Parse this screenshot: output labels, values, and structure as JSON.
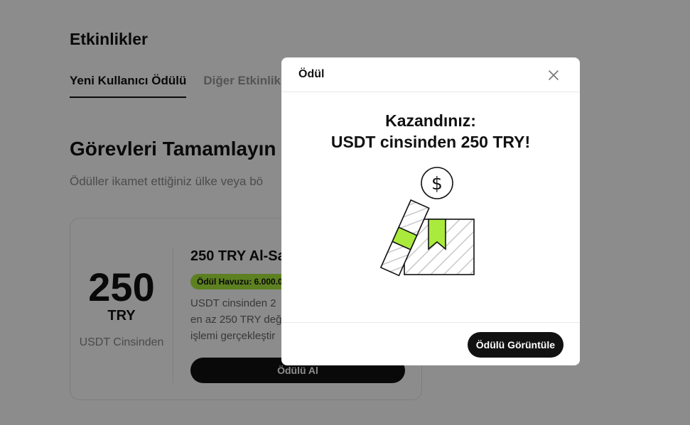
{
  "page": {
    "title": "Etkinlikler",
    "tabs": [
      {
        "label": "Yeni Kullanıcı Ödülü",
        "active": true
      },
      {
        "label": "Diğer Etkinlik"
      }
    ],
    "section_title": "Görevleri Tamamlayın v",
    "section_subtitle": "Ödüller ikamet ettiğiniz ülke veya bö"
  },
  "task_card": {
    "amount": "250",
    "currency": "TRY",
    "note": "USDT Cinsinden",
    "title": "250 TRY Al-Sa",
    "pool_badge": "Ödül Havuzu: 6.000.0",
    "description_lines": [
      "USDT cinsinden 2",
      "en az 250 TRY değ",
      "işlemi gerçekleştir"
    ],
    "button_label": "Ödülü Al"
  },
  "modal": {
    "title": "Ödül",
    "headline_line1": "Kazandınız:",
    "headline_line2": "USDT cinsinden 250 TRY!",
    "illustration_icons": [
      "dollar-coin-icon",
      "ticket-icon",
      "gift-box-icon"
    ],
    "button_label": "Ödülü Görüntüle"
  },
  "colors": {
    "accent_green": "#a9ea3c",
    "primary_black": "#111111",
    "overlay": "rgba(0,0,0,0.45)"
  }
}
